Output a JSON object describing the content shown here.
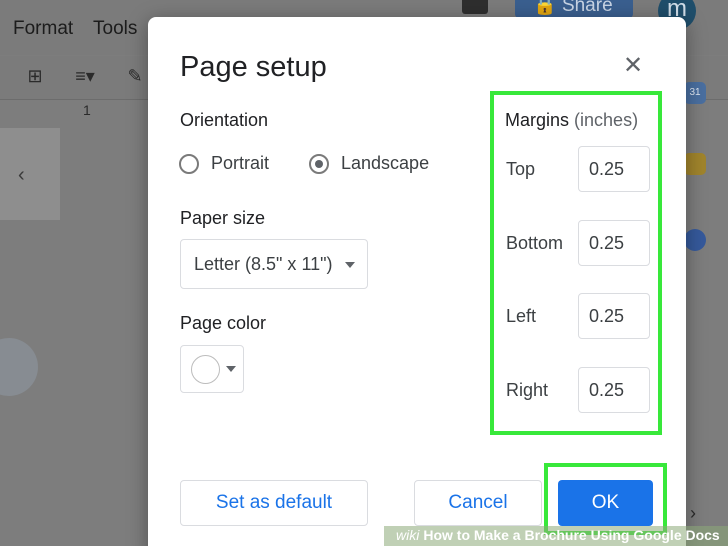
{
  "background": {
    "menu": [
      "Format",
      "Tools"
    ],
    "share_label": "Share",
    "avatar_letter": "m",
    "ruler_mark": "1",
    "side_badge": "31"
  },
  "dialog": {
    "title": "Page setup",
    "close_icon": "close-icon",
    "orientation": {
      "label": "Orientation",
      "options": [
        "Portrait",
        "Landscape"
      ],
      "selected": "Landscape"
    },
    "paper_size": {
      "label": "Paper size",
      "value": "Letter (8.5\" x 11\")"
    },
    "page_color": {
      "label": "Page color",
      "value": "#ffffff"
    },
    "margins": {
      "label": "Margins",
      "unit": "(inches)",
      "fields": [
        {
          "label": "Top",
          "value": "0.25"
        },
        {
          "label": "Bottom",
          "value": "0.25"
        },
        {
          "label": "Left",
          "value": "0.25"
        },
        {
          "label": "Right",
          "value": "0.25"
        }
      ]
    },
    "buttons": {
      "default_label": "Set as default",
      "cancel_label": "Cancel",
      "ok_label": "OK"
    }
  },
  "colors": {
    "highlight": "#38e83a",
    "primary": "#1a73e8"
  },
  "watermark": {
    "prefix": "wiki",
    "text": "How to Make a Brochure Using Google Docs"
  }
}
